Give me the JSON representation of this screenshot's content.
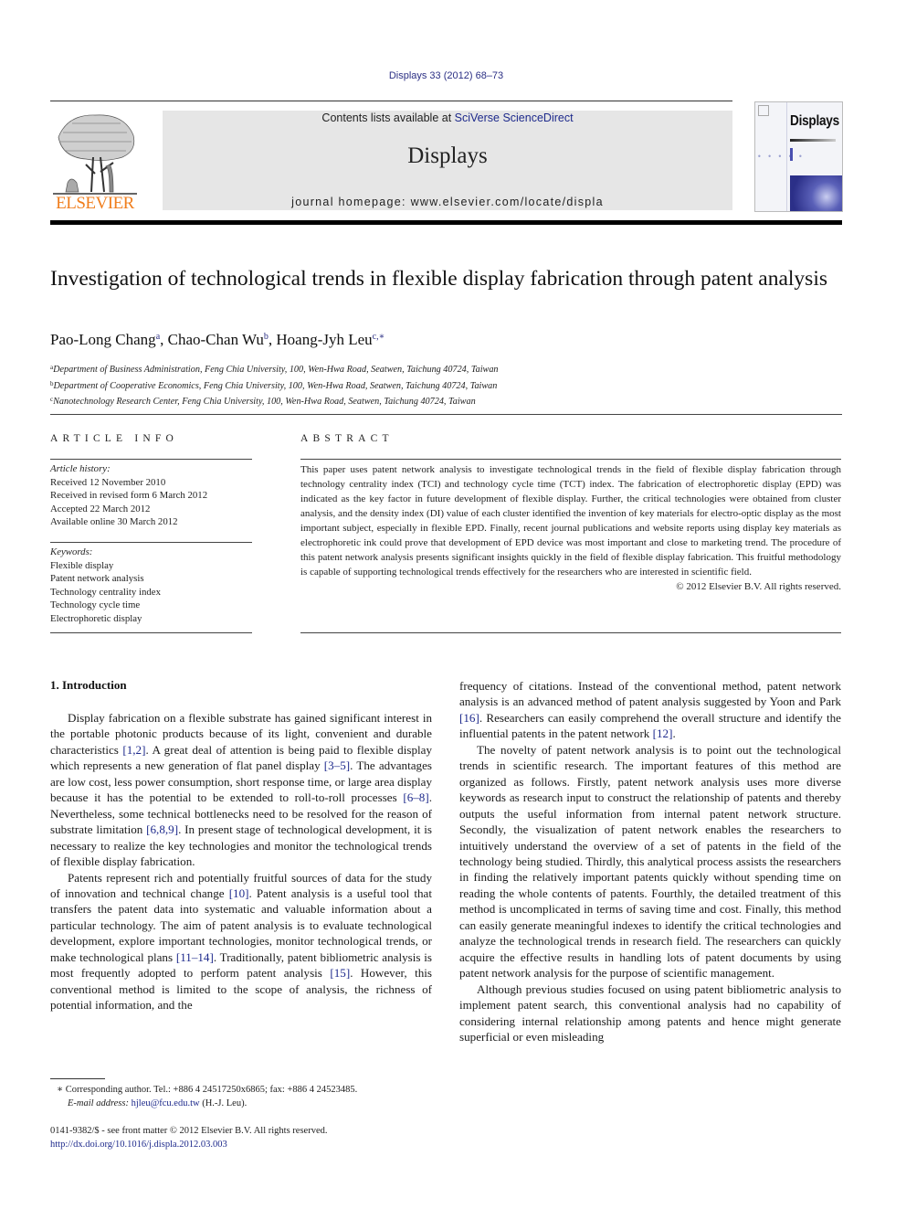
{
  "header": {
    "citation": "Displays 33 (2012) 68–73",
    "contents_prefix": "Contents lists available at ",
    "contents_link": "SciVerse ScienceDirect",
    "journal_name": "Displays",
    "homepage_prefix": "journal homepage: ",
    "homepage_url": "www.elsevier.com/locate/displa",
    "publisher_logo_text": "ELSEVIER",
    "cover_title": "Displays",
    "cover_dots": "• • • • •"
  },
  "article": {
    "title": "Investigation of technological trends in flexible display fabrication through patent analysis",
    "authors": [
      {
        "name": "Pao-Long Chang",
        "sup": "a",
        "sep": ", "
      },
      {
        "name": "Chao-Chan Wu",
        "sup": "b",
        "sep": ", "
      },
      {
        "name": "Hoang-Jyh Leu",
        "sup": "c,∗",
        "sep": ""
      }
    ],
    "affiliations": [
      {
        "sup": "a",
        "text": "Department of Business Administration, Feng Chia University, 100, Wen-Hwa Road, Seatwen, Taichung 40724, Taiwan"
      },
      {
        "sup": "b",
        "text": "Department of Cooperative Economics, Feng Chia University, 100, Wen-Hwa Road, Seatwen, Taichung 40724, Taiwan"
      },
      {
        "sup": "c",
        "text": "Nanotechnology Research Center, Feng Chia University, 100, Wen-Hwa Road, Seatwen, Taichung 40724, Taiwan"
      }
    ]
  },
  "article_info": {
    "heading": "ARTICLE INFO",
    "history_label": "Article history:",
    "history": [
      "Received 12 November 2010",
      "Received in revised form 6 March 2012",
      "Accepted 22 March 2012",
      "Available online 30 March 2012"
    ],
    "keywords_label": "Keywords:",
    "keywords": [
      "Flexible display",
      "Patent network analysis",
      "Technology centrality index",
      "Technology cycle time",
      "Electrophoretic display"
    ]
  },
  "abstract": {
    "heading": "ABSTRACT",
    "text": "This paper uses patent network analysis to investigate technological trends in the field of flexible display fabrication through technology centrality index (TCI) and technology cycle time (TCT) index. The fabrication of electrophoretic display (EPD) was indicated as the key factor in future development of flexible display. Further, the critical technologies were obtained from cluster analysis, and the density index (DI) value of each cluster identified the invention of key materials for electro-optic display as the most important subject, especially in flexible EPD. Finally, recent journal publications and website reports using display key materials as electrophoretic ink could prove that development of EPD device was most important and close to marketing trend. The procedure of this patent network analysis presents significant insights quickly in the field of flexible display fabrication. This fruitful methodology is capable of supporting technological trends effectively for the researchers who are interested in scientific field.",
    "copyright": "© 2012 Elsevier B.V. All rights reserved."
  },
  "body": {
    "section_heading": "1. Introduction",
    "left_paragraphs": [
      [
        {
          "t": "Display fabrication on a flexible substrate has gained significant interest in the portable photonic products because of its light, convenient and durable characteristics "
        },
        {
          "ref": "[1,2]"
        },
        {
          "t": ". A great deal of attention is being paid to flexible display which represents a new generation of flat panel display "
        },
        {
          "ref": "[3–5]"
        },
        {
          "t": ". The advantages are low cost, less power consumption, short response time, or large area display because it has the potential to be extended to roll-to-roll processes "
        },
        {
          "ref": "[6–8]"
        },
        {
          "t": ". Nevertheless, some technical bottlenecks need to be resolved for the reason of substrate limitation "
        },
        {
          "ref": "[6,8,9]"
        },
        {
          "t": ". In present stage of technological development, it is necessary to realize the key technologies and monitor the technological trends of flexible display fabrication."
        }
      ],
      [
        {
          "t": "Patents represent rich and potentially fruitful sources of data for the study of innovation and technical change "
        },
        {
          "ref": "[10]"
        },
        {
          "t": ". Patent analysis is a useful tool that transfers the patent data into systematic and valuable information about a particular technology. The aim of patent analysis is to evaluate technological development, explore important technologies, monitor technological trends, or make technological plans "
        },
        {
          "ref": "[11–14]"
        },
        {
          "t": ". Traditionally, patent bibliometric analysis is most frequently adopted to perform patent analysis "
        },
        {
          "ref": "[15]"
        },
        {
          "t": ". However, this conventional method is limited to the scope of analysis, the richness of potential information, and the"
        }
      ]
    ],
    "right_paragraphs": [
      [
        {
          "t": "frequency of citations. Instead of the conventional method, patent network analysis is an advanced method of patent analysis suggested by Yoon and Park "
        },
        {
          "ref": "[16]"
        },
        {
          "t": ". Researchers can easily comprehend the overall structure and identify the influential patents in the patent network "
        },
        {
          "ref": "[12]"
        },
        {
          "t": "."
        }
      ],
      [
        {
          "t": "The novelty of patent network analysis is to point out the technological trends in scientific research. The important features of this method are organized as follows. Firstly, patent network analysis uses more diverse keywords as research input to construct the relationship of patents and thereby outputs the useful information from internal patent network structure. Secondly, the visualization of patent network enables the researchers to intuitively understand the overview of a set of patents in the field of the technology being studied. Thirdly, this analytical process assists the researchers in finding the relatively important patents quickly without spending time on reading the whole contents of patents. Fourthly, the detailed treatment of this method is uncomplicated in terms of saving time and cost. Finally, this method can easily generate meaningful indexes to identify the critical technologies and analyze the technological trends in research field. The researchers can quickly acquire the effective results in handling lots of patent documents by using patent network analysis for the purpose of scientific management."
        }
      ],
      [
        {
          "t": "Although previous studies focused on using patent bibliometric analysis to implement patent search, this conventional analysis had no capability of considering internal relationship among patents and hence might generate superficial or even misleading"
        }
      ]
    ]
  },
  "footnote": {
    "mark": "∗",
    "text": "Corresponding author. Tel.: +886 4 24517250x6865; fax: +886 4 24523485.",
    "email_label": "E-mail address:",
    "email": "hjleu@fcu.edu.tw",
    "email_suffix": " (H.-J. Leu)."
  },
  "front_matter": {
    "issn_line": "0141-9382/$ - see front matter © 2012 Elsevier B.V. All rights reserved.",
    "doi_link": "http://dx.doi.org/10.1016/j.displa.2012.03.003"
  },
  "colors": {
    "link": "#1e2a8c",
    "elsevier_orange": "#f07e1d",
    "header_gray": "#e6e6e6"
  }
}
